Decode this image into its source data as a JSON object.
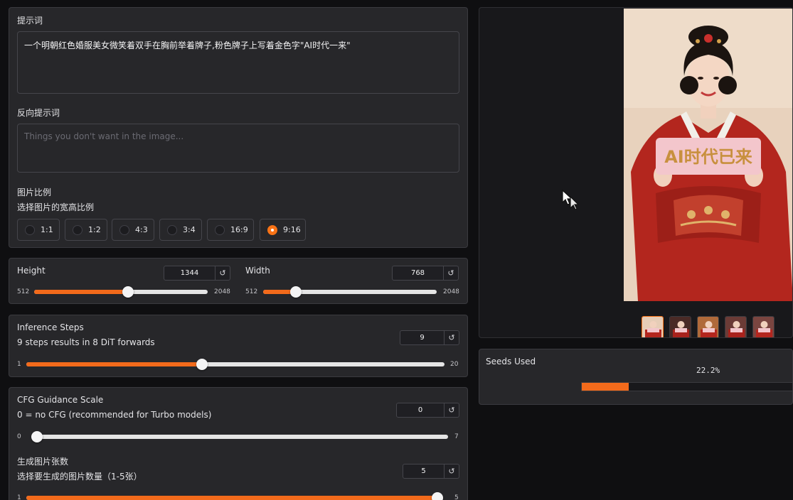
{
  "prompt": {
    "label": "提示词",
    "value": "一个明朝红色婚服美女微笑着双手在胸前举着牌子,粉色牌子上写着金色字\"AI时代一来\""
  },
  "negative_prompt": {
    "label": "反向提示词",
    "placeholder": "Things you don't want in the image..."
  },
  "aspect_ratio": {
    "label": "图片比例",
    "info": "选择图片的宽高比例",
    "options": [
      "1:1",
      "1:2",
      "4:3",
      "3:4",
      "16:9",
      "9:16"
    ],
    "selected": "9:16"
  },
  "height": {
    "label": "Height",
    "value": "1344",
    "min": "512",
    "max": "2048",
    "level": 0.54
  },
  "width": {
    "label": "Width",
    "value": "768",
    "min": "512",
    "max": "2048",
    "level": 0.19
  },
  "inference_steps": {
    "label": "Inference Steps",
    "info": "9 steps results in 8 DiT forwards",
    "value": "9",
    "min": "1",
    "max": "20",
    "level": 0.42
  },
  "cfg": {
    "label": "CFG Guidance Scale",
    "info": "0 = no CFG (recommended for Turbo models)",
    "value": "0",
    "min": "0",
    "max": "7",
    "level": 0.0
  },
  "num_images": {
    "label": "生成图片张数",
    "info": "选择要生成的图片数量（1-5张）",
    "value": "5",
    "min": "1",
    "max": "5",
    "level": 1.0
  },
  "reset_glyph": "↺",
  "output": {
    "sign_text": "AI时代已来",
    "thumbnail_count": 5
  },
  "seeds": {
    "label": "Seeds Used",
    "progress_text": "22.2%",
    "progress": 0.222
  },
  "colors": {
    "accent": "#f26a1b",
    "panel": "#27272a",
    "background": "#0f0f11"
  }
}
